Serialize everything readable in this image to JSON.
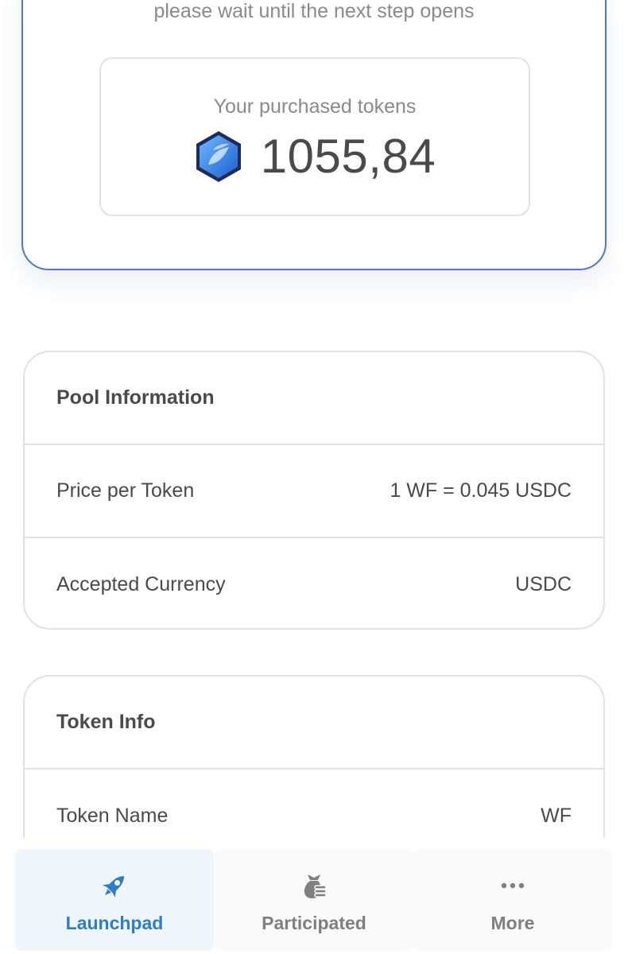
{
  "top_card": {
    "wait_text": "please wait until the next step opens",
    "purchased_label": "Your purchased tokens",
    "purchased_value": "1055,84",
    "token_icon": "blue-hexagon-token-icon"
  },
  "pool_info": {
    "title": "Pool Information",
    "rows": [
      {
        "label": "Price per Token",
        "value": "1 WF = 0.045 USDC"
      },
      {
        "label": "Accepted Currency",
        "value": "USDC"
      }
    ]
  },
  "token_info": {
    "title": "Token Info",
    "rows": [
      {
        "label": "Token Name",
        "value": "WF"
      }
    ]
  },
  "bottom_nav": {
    "items": [
      {
        "label": "Launchpad",
        "icon": "rocket-icon",
        "active": true
      },
      {
        "label": "Participated",
        "icon": "money-bag-icon",
        "active": false
      },
      {
        "label": "More",
        "icon": "more-dots-icon",
        "active": false
      }
    ]
  },
  "colors": {
    "accent": "#2f7ccc",
    "card_border_active": "#4a78d6",
    "border": "#e2e2e2",
    "text": "#4a4a4a",
    "muted_text": "#8a8a8a"
  }
}
